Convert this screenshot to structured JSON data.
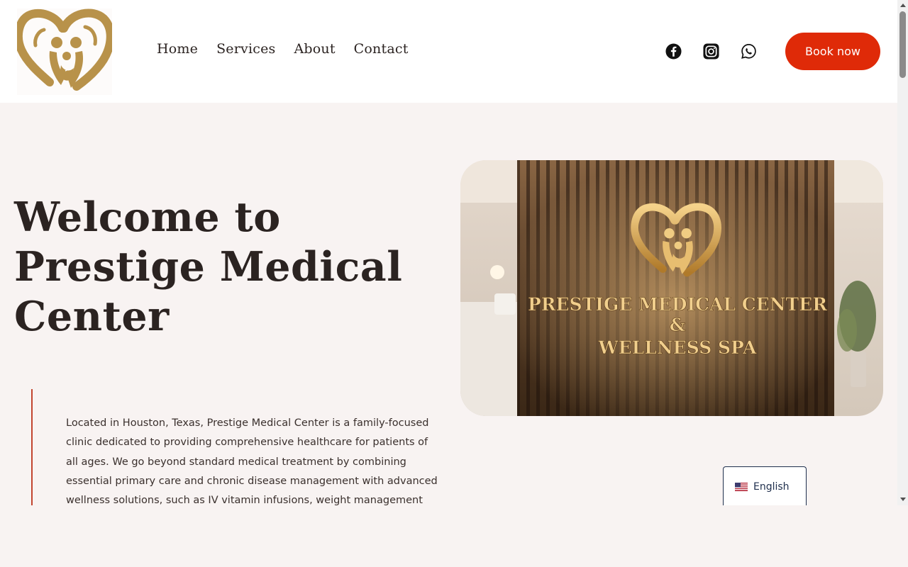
{
  "header": {
    "nav": [
      {
        "label": "Home"
      },
      {
        "label": "Services"
      },
      {
        "label": "About"
      },
      {
        "label": "Contact"
      }
    ],
    "social": [
      "facebook-icon",
      "instagram-icon",
      "whatsapp-icon"
    ],
    "book_label": "Book now"
  },
  "hero": {
    "title": "Welcome to Prestige Medical Center",
    "description": "Located in Houston, Texas, Prestige Medical Center is a family-focused clinic dedicated to providing comprehensive healthcare for patients of all ages. We go beyond standard medical treatment by combining essential primary care and chronic disease management with advanced wellness solutions, such as IV vitamin infusions, weight management",
    "image_sign": {
      "line1": "PRESTIGE MEDICAL CENTER",
      "line2": "&",
      "line3": "WELLNESS SPA"
    }
  },
  "language": {
    "selected": "English",
    "flag": "us-flag-icon"
  },
  "colors": {
    "accent": "#df2a08",
    "gold": "#b8924a",
    "background": "#f8f3f2",
    "text": "#2b2321",
    "navy": "#1f2f4d"
  }
}
